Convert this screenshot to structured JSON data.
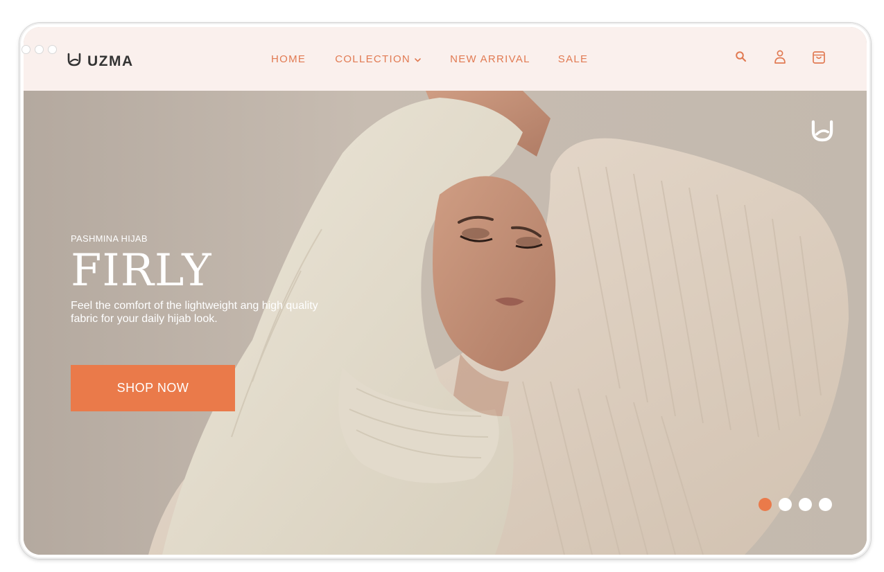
{
  "brand": {
    "name": "UZMA"
  },
  "nav": {
    "links": [
      {
        "label": "HOME"
      },
      {
        "label": "COLLECTION"
      },
      {
        "label": "NEW ARRIVAL"
      },
      {
        "label": "SALE"
      }
    ],
    "icons": [
      "search-icon",
      "user-icon",
      "cart-icon"
    ]
  },
  "hero": {
    "eyebrow": "PASHMINA HIJAB",
    "title": "FIRLY",
    "description": "Feel the comfort of the lightweight ang high quality fabric for your daily hijab look.",
    "cta": "SHOP NOW",
    "slides_total": 4,
    "active_slide": 1
  },
  "colors": {
    "accent": "#ea7a4a",
    "nav_bg": "#faf0ed",
    "nav_text": "#e17a52"
  }
}
